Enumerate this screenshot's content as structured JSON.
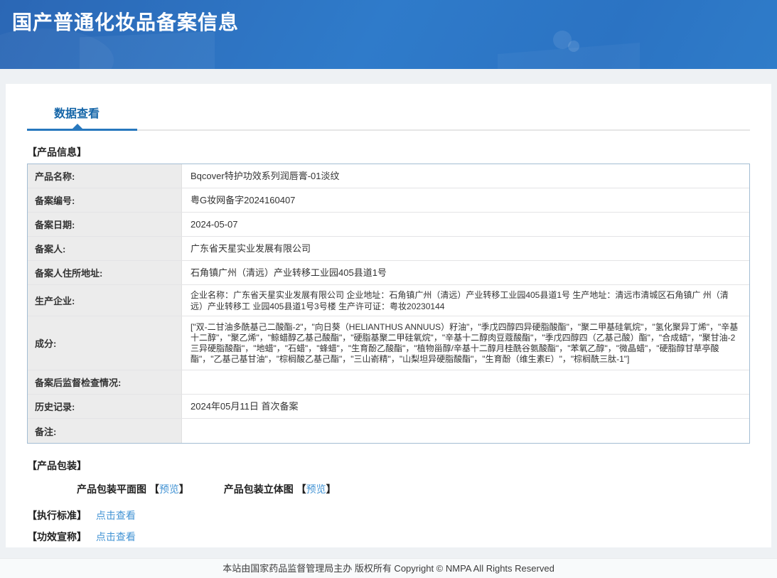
{
  "header": {
    "title": "国产普通化妆品备案信息"
  },
  "tabs": {
    "data_view": "数据查看"
  },
  "sections": {
    "product_info": "【产品信息】",
    "packaging": "【产品包装】",
    "standard": "【执行标准】",
    "efficacy": "【功效宣称】"
  },
  "table": {
    "rows": [
      {
        "label": "产品名称:",
        "value": "Bqcover特护功效系列润唇膏-01淡纹"
      },
      {
        "label": "备案编号:",
        "value": "粤G妆网备字2024160407"
      },
      {
        "label": "备案日期:",
        "value": "2024-05-07"
      },
      {
        "label": "备案人:",
        "value": "广东省天星实业发展有限公司"
      },
      {
        "label": "备案人住所地址:",
        "value": "石角镇广州（清远）产业转移工业园405县道1号"
      },
      {
        "label": "生产企业:",
        "value": "企业名称：广东省天星实业发展有限公司 企业地址：石角镇广州（清远）产业转移工业园405县道1号 生产地址：清远市清城区石角镇广 州（清远）产业转移工 业园405县道1号3号楼 生产许可证：粤妆20230144"
      },
      {
        "label": "成分:",
        "value": "[\"双-二甘油多酰基己二酸酯-2\"，\"向日葵（HELIANTHUS ANNUUS）籽油\"，\"季戊四醇四异硬脂酸酯\"，\"聚二甲基硅氧烷\"，\"氢化聚异丁烯\"，\"辛基十二醇\"，\"聚乙烯\"，\"鲸蜡醇乙基己酸酯\"，\"硬脂基聚二甲硅氧烷\"，\"辛基十二醇肉豆蔻酸酯\"，\"季戊四醇四（乙基己酸）酯\"，\"合成蜡\"，\"聚甘油-2 三异硬脂酸酯\"，\"地蜡\"，\"石蜡\"，\"蜂蜡\"，\"生育酚乙酸酯\"，\"植物甾醇/辛基十二醇月桂酰谷氨酸酯\"，\"苯氧乙醇\"，\"微晶蜡\"，\"硬脂醇甘草亭酸酯\"，\"乙基己基甘油\"，\"棕榈酸乙基己酯\"，\"三山嵛精\"，\"山梨坦异硬脂酸酯\"，\"生育酚（维生素E）\"，\"棕榈酰三肽-1\"]"
      },
      {
        "label": "备案后监督检查情况:",
        "value": ""
      },
      {
        "label": "历史记录:",
        "value": "2024年05月11日 首次备案"
      },
      {
        "label": "备注:",
        "value": ""
      }
    ]
  },
  "packaging": {
    "flat_label": "产品包装平面图",
    "stereo_label": "产品包装立体图 ",
    "preview_label": "预览",
    "bracket_open": "【",
    "bracket_close": "】"
  },
  "links": {
    "click_view_standard": "点击查看",
    "click_view_efficacy": "点击查看"
  },
  "footer": {
    "text": "本站由国家药品监督管理局主办 版权所有 Copyright © NMPA All Rights Reserved"
  },
  "colors": {
    "header_blue_start": "#2b67b5",
    "header_blue_end": "#2f7cc9",
    "tab_blue": "#1465a8",
    "tab_bar_blue": "#2878be",
    "link_blue": "#4293d4",
    "table_border": "#a3bdd3",
    "label_cell_bg": "#ececec",
    "page_bg": "#eef1f4"
  }
}
